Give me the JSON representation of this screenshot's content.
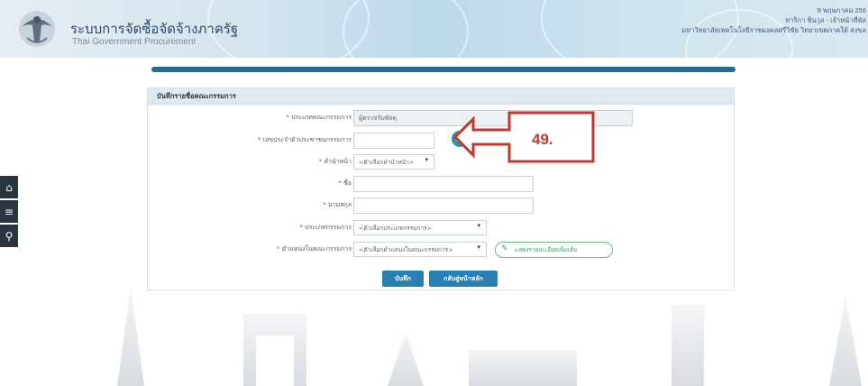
{
  "header": {
    "title_th": "ระบบการจัดซื้อจัดจ้างภาครัฐ",
    "title_en": "Thai Government Procurement",
    "date": "9 พฤษภาคม 256",
    "user_line": "ทาริกา ชินวุล - เจ้าหน้าที่พัส",
    "org_line": "มหาวิทยาลัยเทคโนโลยีราชมงคลศรีวิชัย วิทยาเขตภาคใต้ สงขล"
  },
  "sidebar": {
    "icons": [
      "home-icon",
      "menu-icon",
      "search-icon"
    ],
    "glyphs": [
      "⌂",
      "≡",
      "⚲"
    ]
  },
  "form": {
    "heading": "บันทึกรายชื่อคณะกรรมการ",
    "fields": [
      {
        "label": "ประเภทคณะกรรมการ",
        "value": "ผู้ตรวจรับพัสดุ"
      },
      {
        "label": "เลขประจำตัวประชาชนกรรมการ",
        "value": ""
      },
      {
        "label": "คำนำหน้า",
        "value": "<ตัวเลือกคำนำหน้า>"
      },
      {
        "label": "ชื่อ",
        "value": ""
      },
      {
        "label": "นามสกุล",
        "value": ""
      },
      {
        "label": "ประเภทกรรมการ",
        "value": "<ตัวเลือกประเภทกรรมการ>"
      },
      {
        "label": "ตำแหน่งในคณะกรรมการ",
        "value": "<ตัวเลือกตำแหน่งในคณะกรรมการ>"
      }
    ],
    "required_mark": "*",
    "detail_button": "แสดงรายละเอียดเพิ่มเติม",
    "save_button": "บันทึก",
    "back_button": "กลับสู่หน้าหลัก"
  },
  "annotation": {
    "step_number": "49.",
    "color": "#c0392b"
  },
  "colors": {
    "primary": "#2a7fb2",
    "rule": "#1f6f96",
    "header_text": "#2d4a77",
    "sidebar": "#2a3540"
  }
}
